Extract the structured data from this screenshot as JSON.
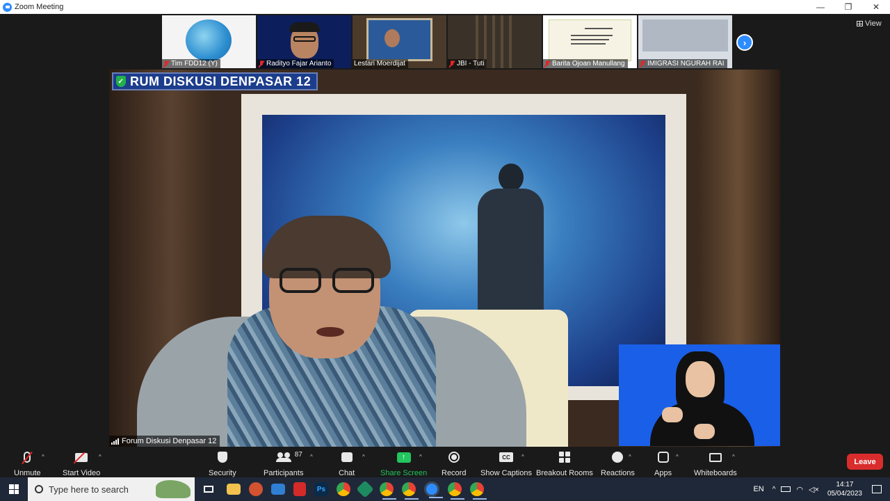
{
  "window": {
    "title": "Zoom Meeting",
    "minimize": "—",
    "restore": "❐",
    "close": "✕"
  },
  "view_button": "View",
  "thumbnails": [
    {
      "name": "Tim FDD12 (Y)",
      "muted": true
    },
    {
      "name": "Radityo Fajar Arianto",
      "muted": true
    },
    {
      "name": "Lestari Moerdijat",
      "muted": false
    },
    {
      "name": "JBI - Tuti",
      "muted": true
    },
    {
      "name": "Barita Ojoan Manullang",
      "muted": true
    },
    {
      "name": "IMIGRASI NGURAH RAI",
      "muted": true
    }
  ],
  "main_video": {
    "overlay_label": "RUM DISKUSI DENPASAR 12",
    "speaker_name": "Forum Diskusi Denpasar 12"
  },
  "toolbar": {
    "unmute": "Unmute",
    "start_video": "Start Video",
    "security": "Security",
    "participants": "Participants",
    "participants_count": "87",
    "chat": "Chat",
    "share_screen": "Share Screen",
    "record": "Record",
    "show_captions": "Show Captions",
    "breakout_rooms": "Breakout Rooms",
    "reactions": "Reactions",
    "apps": "Apps",
    "whiteboards": "Whiteboards",
    "leave": "Leave",
    "cc_text": "CC",
    "share_arrow": "↑"
  },
  "taskbar": {
    "search_placeholder": "Type here to search",
    "language": "EN",
    "time": "14:17",
    "date": "05/04/2023",
    "apps": [
      {
        "name": "task-view",
        "color": "#ffffff"
      },
      {
        "name": "file-explorer",
        "color": "#f2c14e"
      },
      {
        "name": "powerpoint",
        "color": "#d35230"
      },
      {
        "name": "mail",
        "color": "#2f7fd3"
      },
      {
        "name": "acrobat",
        "color": "#d42a2a"
      },
      {
        "name": "photoshop",
        "color": "#0b2a4a"
      },
      {
        "name": "chrome",
        "color": "#2fa84f"
      },
      {
        "name": "app-green",
        "color": "#1e8a60"
      },
      {
        "name": "chrome",
        "color": "#2fa84f"
      },
      {
        "name": "chrome",
        "color": "#2fa84f"
      },
      {
        "name": "zoom",
        "color": "#2d8cff"
      },
      {
        "name": "chrome",
        "color": "#2fa84f"
      },
      {
        "name": "chrome",
        "color": "#2fa84f"
      }
    ]
  },
  "colors": {
    "zoom_blue": "#2d8cff",
    "leave_red": "#d92d2d",
    "share_green": "#22c55e",
    "mute_red": "#e02828"
  }
}
